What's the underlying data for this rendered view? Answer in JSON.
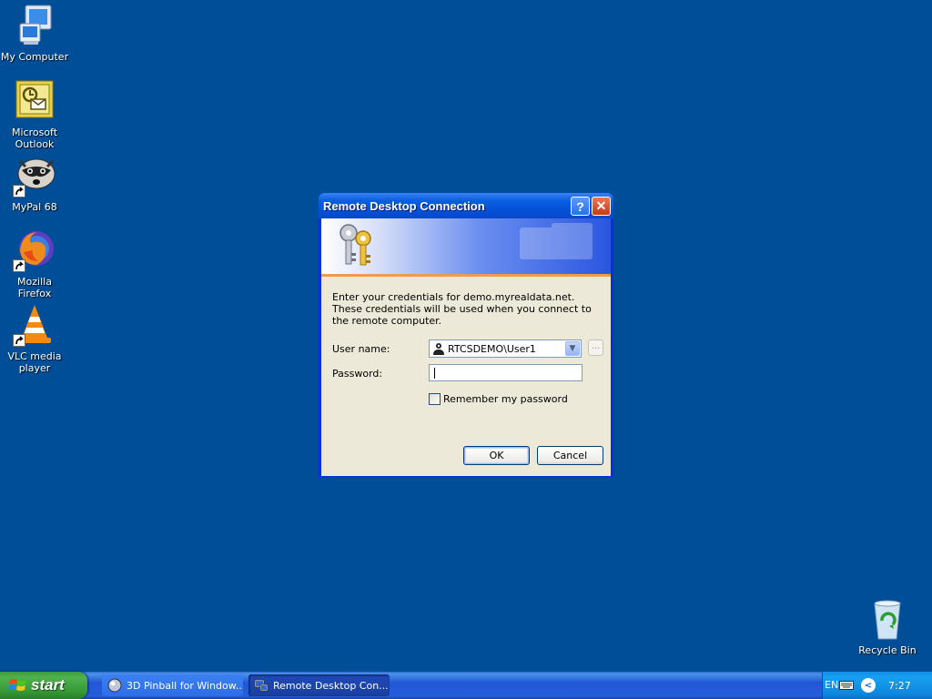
{
  "desktop": {
    "icons": [
      {
        "label": "My Computer",
        "icon": "my-computer-icon"
      },
      {
        "label": "Microsoft Outlook",
        "icon": "outlook-icon"
      },
      {
        "label": "MyPal 68",
        "icon": "mypal-icon"
      },
      {
        "label": "Mozilla Firefox",
        "icon": "firefox-icon"
      },
      {
        "label": "VLC media player",
        "icon": "vlc-icon"
      }
    ],
    "recycle_bin": {
      "label": "Recycle Bin",
      "icon": "recycle-bin-icon"
    }
  },
  "dialog": {
    "title": "Remote Desktop Connection",
    "help_glyph": "?",
    "close_glyph": "✕",
    "message": "Enter your credentials for demo.myrealdata.net. These credentials will be used when you connect to the remote computer.",
    "username_label": "User name:",
    "username_value": "RTCSDEMO\\User1",
    "browse_label": "...",
    "password_label": "Password:",
    "password_value": "",
    "remember_label": "Remember my password",
    "remember_checked": false,
    "ok_label": "OK",
    "cancel_label": "Cancel"
  },
  "taskbar": {
    "start_label": "start",
    "tasks": [
      {
        "label": "3D Pinball for Window...",
        "icon": "pinball-icon",
        "active": false
      },
      {
        "label": "Remote Desktop Con...",
        "icon": "remote-desktop-icon",
        "active": true
      }
    ],
    "language": "EN",
    "clock": "7:27"
  },
  "colors": {
    "desktop": "#004e98",
    "titlebar": "#0350d8",
    "dialog_face": "#ece9d8",
    "start_button": "#3c9a3c"
  }
}
